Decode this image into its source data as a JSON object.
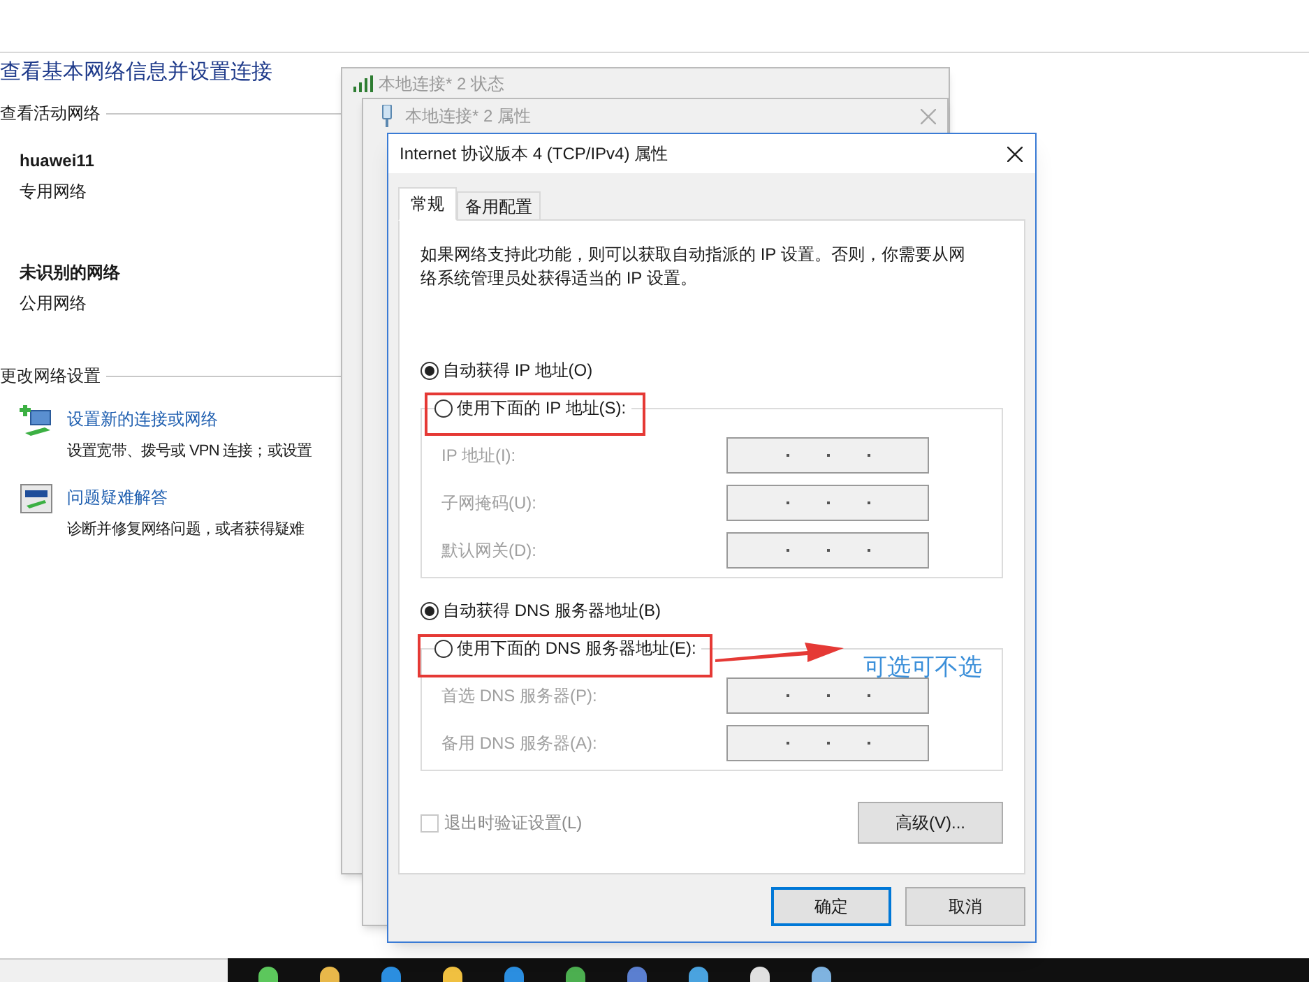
{
  "background_page": {
    "heading": "查看基本网络信息并设置连接",
    "active_networks_label": "查看活动网络",
    "networks": [
      {
        "name": "huawei11",
        "type": "专用网络"
      },
      {
        "name": "未识别的网络",
        "type": "公用网络"
      }
    ],
    "change_settings_label": "更改网络设置",
    "tasks": [
      {
        "kind": "new-connection",
        "link": "设置新的连接或网络",
        "description": "设置宽带、拨号或 VPN 连接；或设置"
      },
      {
        "kind": "troubleshoot",
        "link": "问题疑难解答",
        "description": "诊断并修复网络问题，或者获得疑难"
      }
    ]
  },
  "status_window": {
    "title": "本地连接* 2 状态"
  },
  "properties_window": {
    "title": "本地连接* 2 属性"
  },
  "dialog": {
    "title": "Internet 协议版本 4 (TCP/IPv4) 属性",
    "tabs": [
      {
        "label": "常规",
        "selected": true
      },
      {
        "label": "备用配置",
        "selected": false
      }
    ],
    "intro": "如果网络支持此功能，则可以获取自动指派的 IP 设置。否则，你需要从网络系统管理员处获得适当的 IP 设置。",
    "ip_options": [
      {
        "label": "自动获得 IP 地址(O)",
        "selected": true
      },
      {
        "label": "使用下面的 IP 地址(S):",
        "selected": false
      }
    ],
    "ip_fields": [
      {
        "label": "IP 地址(I):"
      },
      {
        "label": "子网掩码(U):"
      },
      {
        "label": "默认网关(D):"
      }
    ],
    "dns_options": [
      {
        "label": "自动获得 DNS 服务器地址(B)",
        "selected": true
      },
      {
        "label": "使用下面的 DNS 服务器地址(E):",
        "selected": false
      }
    ],
    "dns_fields": [
      {
        "label": "首选 DNS 服务器(P):"
      },
      {
        "label": "备用 DNS 服务器(A):"
      }
    ],
    "validate_checkbox": {
      "label": "退出时验证设置(L)",
      "checked": false,
      "disabled": true
    },
    "advanced_button": "高级(V)...",
    "buttons": [
      {
        "label": "确定",
        "default": true
      },
      {
        "label": "取消",
        "default": false
      }
    ]
  },
  "annotation": {
    "note": "可选可不选"
  }
}
